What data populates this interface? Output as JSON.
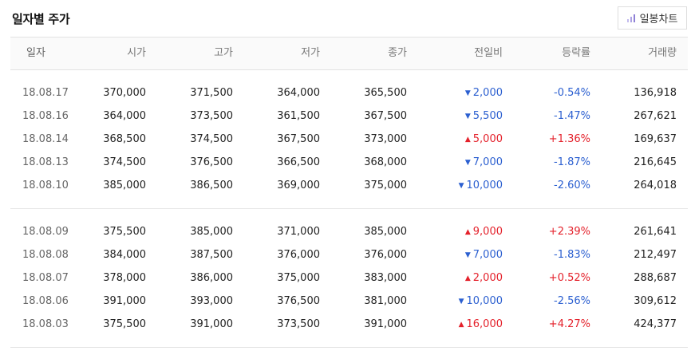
{
  "title": "일자별 주가",
  "chart_button": {
    "label": "일봉차트",
    "icon": "bar-chart-icon"
  },
  "columns": {
    "date": "일자",
    "open": "시가",
    "high": "고가",
    "low": "저가",
    "close": "종가",
    "change": "전일비",
    "rate": "등락률",
    "volume": "거래량"
  },
  "colors": {
    "up": "#e4212b",
    "down": "#2b5fd0"
  },
  "groups": [
    {
      "rows": [
        {
          "date": "18.08.17",
          "open": "370,000",
          "high": "371,500",
          "low": "364,000",
          "close": "365,500",
          "direction": "down",
          "change": "2,000",
          "rate": "-0.54%",
          "volume": "136,918"
        },
        {
          "date": "18.08.16",
          "open": "364,000",
          "high": "373,500",
          "low": "361,500",
          "close": "367,500",
          "direction": "down",
          "change": "5,500",
          "rate": "-1.47%",
          "volume": "267,621"
        },
        {
          "date": "18.08.14",
          "open": "368,500",
          "high": "374,500",
          "low": "367,500",
          "close": "373,000",
          "direction": "up",
          "change": "5,000",
          "rate": "+1.36%",
          "volume": "169,637"
        },
        {
          "date": "18.08.13",
          "open": "374,500",
          "high": "376,500",
          "low": "366,500",
          "close": "368,000",
          "direction": "down",
          "change": "7,000",
          "rate": "-1.87%",
          "volume": "216,645"
        },
        {
          "date": "18.08.10",
          "open": "385,000",
          "high": "386,500",
          "low": "369,000",
          "close": "375,000",
          "direction": "down",
          "change": "10,000",
          "rate": "-2.60%",
          "volume": "264,018"
        }
      ]
    },
    {
      "rows": [
        {
          "date": "18.08.09",
          "open": "375,500",
          "high": "385,000",
          "low": "371,000",
          "close": "385,000",
          "direction": "up",
          "change": "9,000",
          "rate": "+2.39%",
          "volume": "261,641"
        },
        {
          "date": "18.08.08",
          "open": "384,000",
          "high": "387,500",
          "low": "376,000",
          "close": "376,000",
          "direction": "down",
          "change": "7,000",
          "rate": "-1.83%",
          "volume": "212,497"
        },
        {
          "date": "18.08.07",
          "open": "378,000",
          "high": "386,000",
          "low": "375,000",
          "close": "383,000",
          "direction": "up",
          "change": "2,000",
          "rate": "+0.52%",
          "volume": "288,687"
        },
        {
          "date": "18.08.06",
          "open": "391,000",
          "high": "393,000",
          "low": "376,500",
          "close": "381,000",
          "direction": "down",
          "change": "10,000",
          "rate": "-2.56%",
          "volume": "309,612"
        },
        {
          "date": "18.08.03",
          "open": "375,500",
          "high": "391,000",
          "low": "373,500",
          "close": "391,000",
          "direction": "up",
          "change": "16,000",
          "rate": "+4.27%",
          "volume": "424,377"
        }
      ]
    }
  ]
}
